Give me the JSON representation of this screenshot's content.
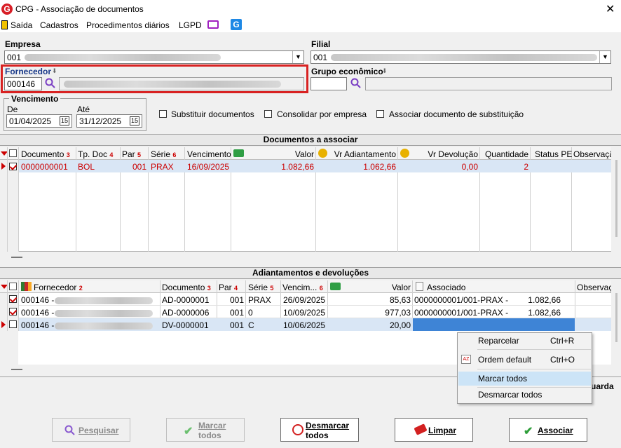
{
  "window": {
    "title": "CPG - Associação de documentos",
    "close": "✕"
  },
  "menu": [
    "Saída",
    "Cadastros",
    "Procedimentos diários",
    "LGPD"
  ],
  "empresa": {
    "label": "Empresa",
    "value": "001"
  },
  "filial": {
    "label": "Filial",
    "value": "001"
  },
  "fornecedor": {
    "label": "Fornecedor",
    "code": "000146"
  },
  "grupo": {
    "label": "Grupo econômico"
  },
  "vencimento": {
    "label": "Vencimento",
    "de_label": "De",
    "de": "01/04/2025",
    "ate_label": "Até",
    "ate": "31/12/2025",
    "cal": "15"
  },
  "options": {
    "substituir": "Substituir documentos",
    "consolidar": "Consolidar por empresa",
    "associar": "Associar documento de substituição"
  },
  "docs": {
    "title": "Documentos a associar",
    "headers": {
      "documento": "Documento",
      "tpdoc": "Tp. Doc",
      "par": "Par",
      "serie": "Série",
      "vencimento": "Vencimento",
      "valor": "Valor",
      "vradiant": "Vr Adiantamento",
      "vrdevol": "Vr Devolução",
      "quantidade": "Quantidade",
      "status": "Status PE",
      "obs": "Observaçã"
    },
    "sort": {
      "documento": "3",
      "tpdoc": "4",
      "par": "5",
      "serie": "6"
    },
    "rows": [
      {
        "documento": "0000000001",
        "tpdoc": "BOL",
        "par": "001",
        "serie": "PRAX",
        "vencimento": "16/09/2025",
        "valor": "1.082,66",
        "vradiant": "1.062,66",
        "vrdevol": "0,00",
        "quantidade": "2"
      }
    ]
  },
  "adiant": {
    "title": "Adiantamentos e devoluções",
    "headers": {
      "fornecedor": "Fornecedor",
      "documento": "Documento",
      "par": "Par",
      "serie": "Série",
      "vencim": "Vencim...",
      "valor": "Valor",
      "associado": "Associado",
      "obs": "Observaç"
    },
    "sort": {
      "fornecedor": "2",
      "documento": "3",
      "par": "4",
      "serie": "5",
      "vencim": "6"
    },
    "rows": [
      {
        "fornecedor": "000146 -",
        "documento": "AD-0000001",
        "par": "001",
        "serie": "PRAX",
        "vencim": "26/09/2025",
        "valor": "85,63",
        "associado": "0000000001/001-PRAX -",
        "assoc_valor": "1.082,66",
        "checked": true
      },
      {
        "fornecedor": "000146 -",
        "documento": "AD-0000006",
        "par": "001",
        "serie": "0",
        "vencim": "10/09/2025",
        "valor": "977,03",
        "associado": "0000000001/001-PRAX -",
        "assoc_valor": "1.082,66",
        "checked": true
      },
      {
        "fornecedor": "000146 -",
        "documento": "DV-0000001",
        "par": "001",
        "serie": "C",
        "vencim": "10/06/2025",
        "valor": "20,00",
        "associado": "",
        "assoc_valor": "",
        "checked": false
      }
    ]
  },
  "context_menu": [
    {
      "label": "Reparcelar",
      "shortcut": "Ctrl+R"
    },
    {
      "label": "Ordem default",
      "shortcut": "Ctrl+O"
    },
    {
      "label": "Marcar todos",
      "shortcut": ""
    },
    {
      "label": "Desmarcar todos",
      "shortcut": ""
    }
  ],
  "partial_label": "uarda",
  "buttons": {
    "pesquisar": "Pesquisar",
    "marcar1": "Marcar",
    "marcar2": "todos",
    "desmarcar1": "Desmarcar",
    "desmarcar2": "todos",
    "limpar": "Limpar",
    "associar": "Associar"
  },
  "colors": {
    "accent_red": "#cc0000",
    "highlight": "#d82222",
    "selection": "#3e84d6",
    "menu_hover": "#cce4f7"
  }
}
